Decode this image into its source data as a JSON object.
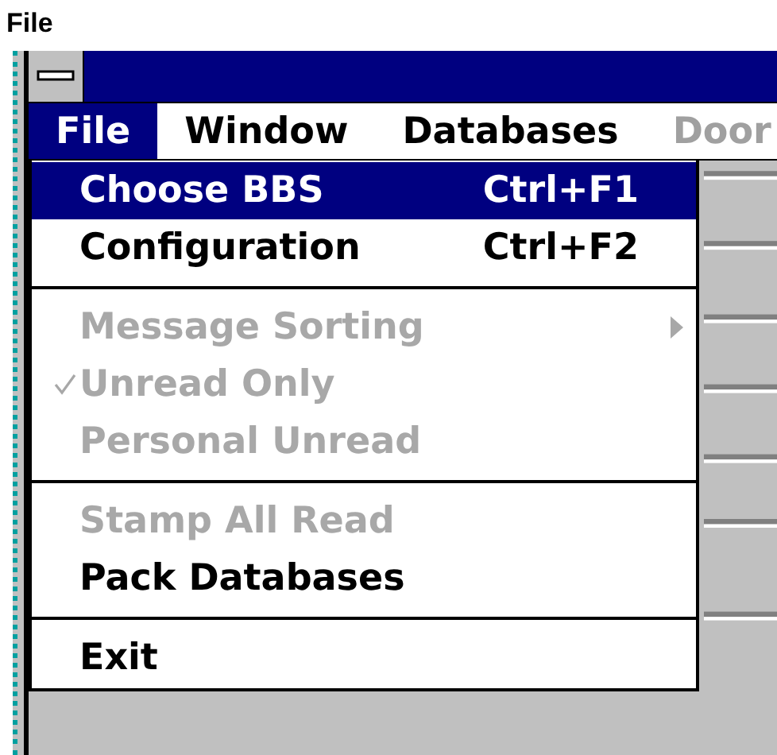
{
  "caption": "File",
  "menu_bar": [
    {
      "label": "File",
      "selected": true,
      "disabled": false
    },
    {
      "label": "Window",
      "selected": false,
      "disabled": false
    },
    {
      "label": "Databases",
      "selected": false,
      "disabled": false
    },
    {
      "label": "Door",
      "selected": false,
      "disabled": true
    }
  ],
  "menu": [
    {
      "kind": "item",
      "label": "Choose BBS",
      "shortcut": "Ctrl+F1",
      "selected": true,
      "disabled": false,
      "checked": false,
      "submenu": false
    },
    {
      "kind": "item",
      "label": "Configuration",
      "shortcut": "Ctrl+F2",
      "selected": false,
      "disabled": false,
      "checked": false,
      "submenu": false
    },
    {
      "kind": "separator"
    },
    {
      "kind": "item",
      "label": "Message Sorting",
      "selected": false,
      "disabled": true,
      "checked": false,
      "submenu": true
    },
    {
      "kind": "item",
      "label": "Unread Only",
      "selected": false,
      "disabled": true,
      "checked": true,
      "submenu": false
    },
    {
      "kind": "item",
      "label": "Personal Unread",
      "selected": false,
      "disabled": true,
      "checked": false,
      "submenu": false
    },
    {
      "kind": "separator"
    },
    {
      "kind": "item",
      "label": "Stamp All Read",
      "selected": false,
      "disabled": true,
      "checked": false,
      "submenu": false
    },
    {
      "kind": "item",
      "label": "Pack Databases",
      "selected": false,
      "disabled": false,
      "checked": false,
      "submenu": false
    },
    {
      "kind": "separator"
    },
    {
      "kind": "item",
      "label": "Exit",
      "selected": false,
      "disabled": false,
      "checked": false,
      "submenu": false
    }
  ]
}
